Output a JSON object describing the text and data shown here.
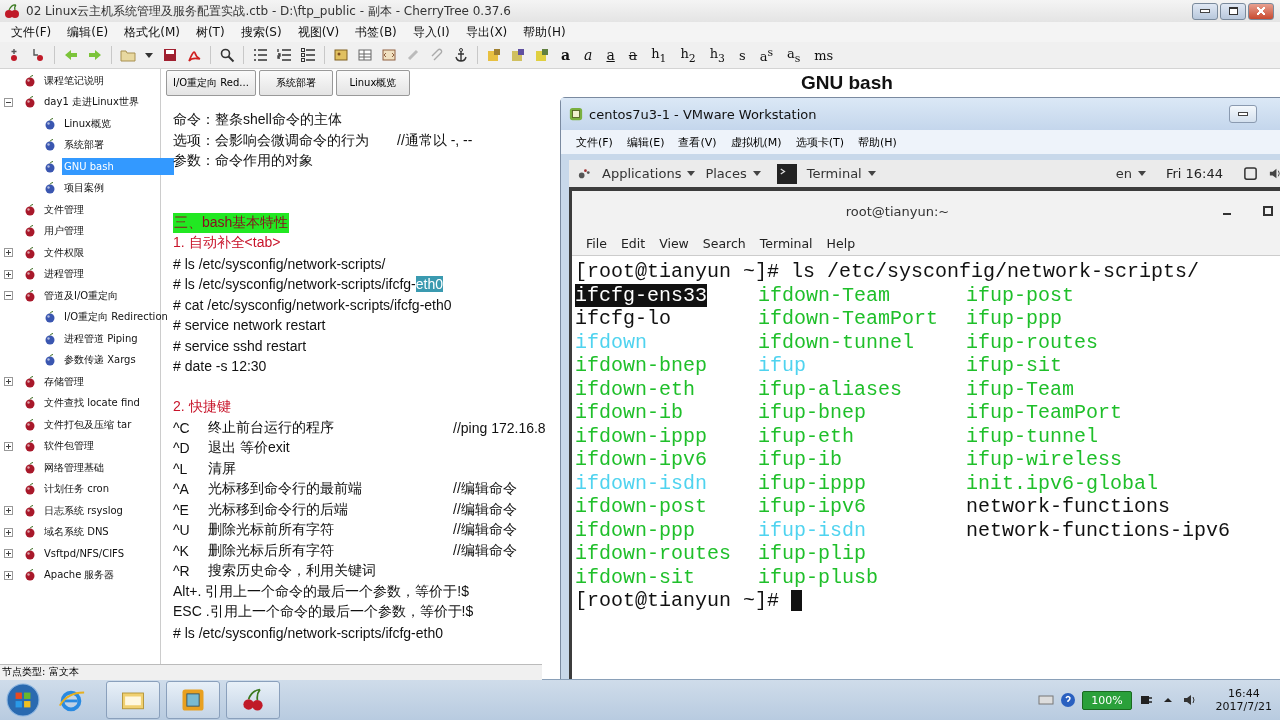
{
  "window": {
    "title": "02 Linux云主机系统管理及服务配置实战.ctb - D:\\ftp_public - 副本 - CherryTree 0.37.6"
  },
  "menu": [
    "文件(F)",
    "编辑(E)",
    "格式化(M)",
    "树(T)",
    "搜索(S)",
    "视图(V)",
    "书签(B)",
    "导入(I)",
    "导出(X)",
    "帮助(H)"
  ],
  "toolbar": {
    "format_buttons": [
      {
        "label": "a",
        "kind": "bold"
      },
      {
        "label": "a",
        "kind": "italic"
      },
      {
        "label": "a",
        "kind": "underline"
      },
      {
        "label": "a",
        "kind": "strike"
      },
      {
        "label": "h$_{1}$",
        "kind": "plain"
      },
      {
        "label": "h$_{2}$",
        "kind": "plain"
      },
      {
        "label": "h$_{3}$",
        "kind": "plain"
      },
      {
        "label": "s",
        "kind": "plain"
      },
      {
        "label": "a$^{s}$",
        "kind": "plain"
      },
      {
        "label": "a$_{s}$",
        "kind": "plain"
      },
      {
        "label": "ms",
        "kind": "plain"
      }
    ]
  },
  "tree": {
    "items": [
      {
        "label": "课程笔记说明",
        "selected": false
      },
      {
        "label": "day1 走进Linux世界",
        "selected": false,
        "expanded": true,
        "children": [
          {
            "label": "Linux概览",
            "selected": false
          },
          {
            "label": "系统部署",
            "selected": false
          },
          {
            "label": "GNU bash",
            "selected": true
          },
          {
            "label": "项目案例",
            "selected": false
          }
        ]
      },
      {
        "label": "文件管理",
        "selected": false
      },
      {
        "label": "用户管理",
        "selected": false
      },
      {
        "label": "文件权限",
        "selected": false,
        "expanded": false
      },
      {
        "label": "进程管理",
        "selected": false,
        "expanded": false
      },
      {
        "label": "管道及I/O重定向",
        "selected": false,
        "expanded": true,
        "children": [
          {
            "label": "I/O重定向 Redirection",
            "selected": false
          },
          {
            "label": "进程管道 Piping",
            "selected": false
          },
          {
            "label": "参数传递 Xargs",
            "selected": false
          }
        ]
      },
      {
        "label": "存储管理",
        "selected": false,
        "expanded": false
      },
      {
        "label": "文件查找 locate find",
        "selected": false
      },
      {
        "label": "文件打包及压缩 tar",
        "selected": false
      },
      {
        "label": "软件包管理",
        "selected": false,
        "expanded": false
      },
      {
        "label": "网络管理基础",
        "selected": false
      },
      {
        "label": "计划任务 cron",
        "selected": false
      },
      {
        "label": "日志系统 rsyslog",
        "selected": false,
        "expanded": false
      },
      {
        "label": "域名系统 DNS",
        "selected": false,
        "expanded": false
      },
      {
        "label": "Vsftpd/NFS/CIFS",
        "selected": false,
        "expanded": false
      },
      {
        "label": "Apache 服务器",
        "selected": false,
        "expanded": false
      }
    ]
  },
  "status_bar": "节点类型: 富文本",
  "editor": {
    "tabs": [
      {
        "label": "I/O重定向 Red...",
        "selected": false
      },
      {
        "label": "系统部署",
        "selected": false
      },
      {
        "label": "Linux概览",
        "selected": false
      }
    ],
    "title": "GNU bash",
    "lines": [
      {
        "kind": "text",
        "text": "命令：整条shell命令的主体"
      },
      {
        "kind": "text",
        "text": "选项：会影响会微调命令的行为",
        "comment": "//通常以 -, --"
      },
      {
        "kind": "text",
        "text": "参数：命令作用的对象"
      },
      {
        "kind": "gap"
      },
      {
        "kind": "gap"
      },
      {
        "kind": "section",
        "text": "三、bash基本特性"
      },
      {
        "kind": "heading",
        "text": "1. 自动补全<tab>"
      },
      {
        "kind": "text",
        "text": "# ls /etc/sysconfig/network-scripts/"
      },
      {
        "kind": "text",
        "text": "# ls /etc/sysconfig/network-scripts/ifcfg-",
        "selection": "eth0"
      },
      {
        "kind": "text",
        "text": "# cat /etc/sysconfig/network-scripts/ifcfg-eth0"
      },
      {
        "kind": "text",
        "text": "# service network restart"
      },
      {
        "kind": "text",
        "text": "# service sshd restart"
      },
      {
        "kind": "text",
        "text": "# date -s 12:30"
      },
      {
        "kind": "gap"
      },
      {
        "kind": "heading",
        "text": "2. 快捷键"
      },
      {
        "kind": "shortcut",
        "key": "^C",
        "text": "终止前台运行的程序",
        "comment": "//ping 172.16.8"
      },
      {
        "kind": "shortcut",
        "key": "^D",
        "text": "退出 等价exit"
      },
      {
        "kind": "shortcut",
        "key": "^L",
        "text": "清屏"
      },
      {
        "kind": "shortcut",
        "key": "^A",
        "text": "光标移到命令行的最前端",
        "comment": "//编辑命令"
      },
      {
        "kind": "shortcut",
        "key": "^E",
        "text": "光标移到命令行的后端",
        "comment": "//编辑命令"
      },
      {
        "kind": "shortcut",
        "key": "^U",
        "text": "删除光标前所有字符",
        "comment": "//编辑命令"
      },
      {
        "kind": "shortcut",
        "key": "^K",
        "text": "删除光标后所有字符",
        "comment": "//编辑命令"
      },
      {
        "kind": "shortcut",
        "key": "^R",
        "text": "搜索历史命令，利用关键词"
      },
      {
        "kind": "text",
        "text": "Alt+. 引用上一个命令的最后一个参数，等价于!$"
      },
      {
        "kind": "text",
        "text": "ESC .引用上一个命令的最后一个参数，等价于!$"
      },
      {
        "kind": "text",
        "text": "# ls /etc/sysconfig/network-scripts/ifcfg-eth0"
      }
    ]
  },
  "vm_window": {
    "title": "centos7u3-1 - VMware Workstation",
    "menu": [
      "文件(F)",
      "编辑(E)",
      "查看(V)",
      "虚拟机(M)",
      "选项卡(T)",
      "帮助(H)"
    ],
    "desktop_bar": {
      "applications": "Applications",
      "places": "Places",
      "app": "Terminal",
      "input": "en",
      "clock": "Fri 16:44"
    },
    "terminal": {
      "title": "root@tianyun:~",
      "menu": [
        "File",
        "Edit",
        "View",
        "Search",
        "Terminal",
        "Help"
      ],
      "prompt": "[root@tianyun ~]#",
      "command": "ls /etc/sysconfig/network-scripts/",
      "final_prompt": "[root@tianyun ~]#",
      "files": [
        {
          "name": "ifcfg-ens33",
          "color": "#111111",
          "highlighted": true
        },
        {
          "name": "ifcfg-lo",
          "color": "#111111",
          "highlighted": false
        },
        {
          "name": "ifdown",
          "color": "#4fd3ef",
          "highlighted": false
        },
        {
          "name": "ifdown-bnep",
          "color": "#1fbf2a",
          "highlighted": false
        },
        {
          "name": "ifdown-eth",
          "color": "#1fbf2a",
          "highlighted": false
        },
        {
          "name": "ifdown-ib",
          "color": "#1fbf2a",
          "highlighted": false
        },
        {
          "name": "ifdown-ippp",
          "color": "#1fbf2a",
          "highlighted": false
        },
        {
          "name": "ifdown-ipv6",
          "color": "#1fbf2a",
          "highlighted": false
        },
        {
          "name": "ifdown-isdn",
          "color": "#4fd3ef",
          "highlighted": false
        },
        {
          "name": "ifdown-post",
          "color": "#1fbf2a",
          "highlighted": false
        },
        {
          "name": "ifdown-ppp",
          "color": "#1fbf2a",
          "highlighted": false
        },
        {
          "name": "ifdown-routes",
          "color": "#1fbf2a",
          "highlighted": false
        },
        {
          "name": "ifdown-sit",
          "color": "#1fbf2a",
          "highlighted": false
        },
        {
          "name": "ifdown-Team",
          "color": "#1fbf2a",
          "highlighted": false
        },
        {
          "name": "ifdown-TeamPort",
          "color": "#1fbf2a",
          "highlighted": false
        },
        {
          "name": "ifdown-tunnel",
          "color": "#1fbf2a",
          "highlighted": false
        },
        {
          "name": "ifup",
          "color": "#4fd3ef",
          "highlighted": false
        },
        {
          "name": "ifup-aliases",
          "color": "#1fbf2a",
          "highlighted": false
        },
        {
          "name": "ifup-bnep",
          "color": "#1fbf2a",
          "highlighted": false
        },
        {
          "name": "ifup-eth",
          "color": "#1fbf2a",
          "highlighted": false
        },
        {
          "name": "ifup-ib",
          "color": "#1fbf2a",
          "highlighted": false
        },
        {
          "name": "ifup-ippp",
          "color": "#1fbf2a",
          "highlighted": false
        },
        {
          "name": "ifup-ipv6",
          "color": "#1fbf2a",
          "highlighted": false
        },
        {
          "name": "ifup-isdn",
          "color": "#4fd3ef",
          "highlighted": false
        },
        {
          "name": "ifup-plip",
          "color": "#1fbf2a",
          "highlighted": false
        },
        {
          "name": "ifup-plusb",
          "color": "#1fbf2a",
          "highlighted": false
        },
        {
          "name": "ifup-post",
          "color": "#1fbf2a",
          "highlighted": false
        },
        {
          "name": "ifup-ppp",
          "color": "#1fbf2a",
          "highlighted": false
        },
        {
          "name": "ifup-routes",
          "color": "#1fbf2a",
          "highlighted": false
        },
        {
          "name": "ifup-sit",
          "color": "#1fbf2a",
          "highlighted": false
        },
        {
          "name": "ifup-Team",
          "color": "#1fbf2a",
          "highlighted": false
        },
        {
          "name": "ifup-TeamPort",
          "color": "#1fbf2a",
          "highlighted": false
        },
        {
          "name": "ifup-tunnel",
          "color": "#1fbf2a",
          "highlighted": false
        },
        {
          "name": "ifup-wireless",
          "color": "#1fbf2a",
          "highlighted": false
        },
        {
          "name": "init.ipv6-global",
          "color": "#1fbf2a",
          "highlighted": false
        },
        {
          "name": "network-functions",
          "color": "#111111",
          "highlighted": false
        },
        {
          "name": "network-functions-ipv6",
          "color": "#111111",
          "highlighted": false
        }
      ]
    }
  },
  "taskbar": {
    "battery": "100%",
    "time": "16:44",
    "date": "2017/7/21"
  }
}
